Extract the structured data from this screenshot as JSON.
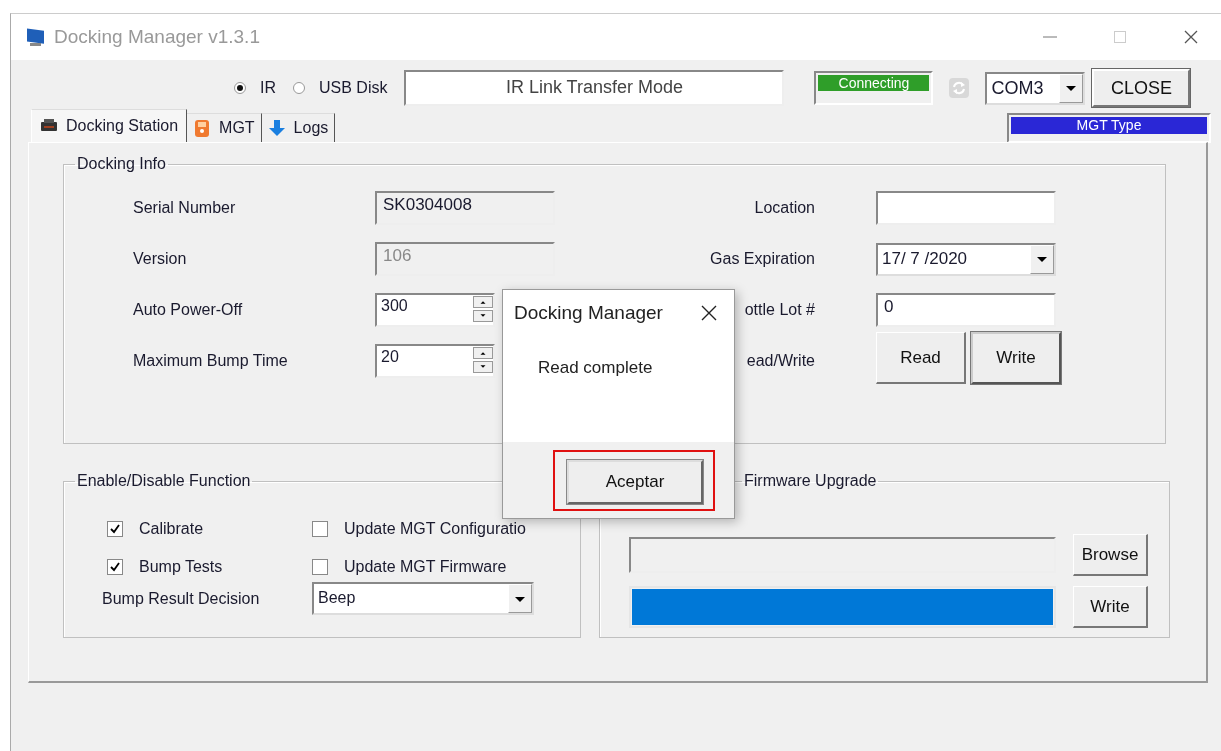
{
  "window": {
    "title": "Docking Manager v1.3.1"
  },
  "connection": {
    "modes": [
      {
        "label": "IR",
        "selected": true
      },
      {
        "label": "USB Disk",
        "selected": false
      }
    ],
    "mode_display": "IR Link Transfer Mode",
    "status": "Connecting",
    "port": "COM3",
    "close_button": "CLOSE",
    "device_type": "MGT Type"
  },
  "tabs": [
    {
      "label": "Docking Station",
      "kind": "dock",
      "selected": true
    },
    {
      "label": "MGT",
      "kind": "device",
      "selected": false
    },
    {
      "label": "Logs",
      "kind": "download",
      "selected": false
    }
  ],
  "docking_info": {
    "title": "Docking Info",
    "left_rows": [
      {
        "label": "Serial Number",
        "kind": "readonly",
        "value": "SK0304008"
      },
      {
        "label": "Version",
        "kind": "disabled",
        "value": "106"
      },
      {
        "label": "Auto Power-Off",
        "kind": "spin",
        "value": "300"
      },
      {
        "label": "Maximum Bump Time",
        "kind": "spin",
        "value": "20"
      }
    ],
    "right_rows": [
      {
        "label": "Location",
        "kind": "text"
      },
      {
        "label": "Gas Expiration",
        "kind": "date",
        "value": "17/ 7 /2020"
      },
      {
        "label": "ottle Lot #",
        "kind": "text",
        "value": "0"
      },
      {
        "label": "ead/Write",
        "kind": "buttons",
        "buttons": [
          {
            "label": "Read",
            "default": false
          },
          {
            "label": "Write",
            "default": true
          }
        ]
      }
    ]
  },
  "functions": {
    "title": "Enable/Disable Function",
    "checkboxes": [
      {
        "label": "Calibrate",
        "checked": true
      },
      {
        "label": "Update MGT Configuratio",
        "checked": false
      },
      {
        "label": "Bump Tests",
        "checked": true
      },
      {
        "label": "Update MGT Firmware",
        "checked": false
      }
    ],
    "decision": {
      "label": "Bump Result Decision",
      "value": "Beep"
    }
  },
  "firmware": {
    "title": "Firmware Upgrade",
    "browse_button": "Browse",
    "progress": {
      "level": 1
    },
    "write_button": "Write"
  },
  "dialog": {
    "title": "Docking Manager",
    "message": "Read complete",
    "button": {
      "label": "Aceptar",
      "highlighted": true
    }
  }
}
